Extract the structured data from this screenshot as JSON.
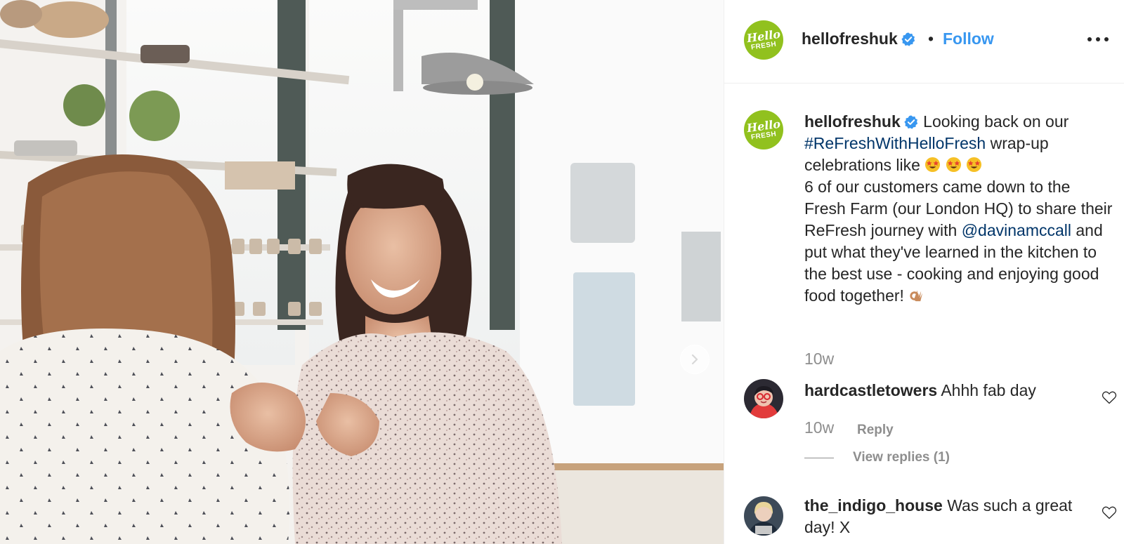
{
  "post": {
    "username": "hellofreshuk",
    "separator": "•",
    "follow_label": "Follow",
    "more_icon": "more-options-icon",
    "avatar_line1": "Hello",
    "avatar_line2": "FRESH",
    "brand_color": "#91c11e",
    "verified_color": "#3897f0"
  },
  "caption": {
    "username": "hellofreshuk",
    "text_1": "Looking back on our",
    "hashtag": "#ReFreshWithHelloFresh",
    "text_2": "wrap-up celebrations like",
    "emoji_1": "star-struck-emoji",
    "text_3": "6 of our customers came down to the Fresh Farm (our London HQ) to share their ReFresh journey with",
    "mention": "@davinamccall",
    "text_4": "and put what they've learned in the kitchen to the best use - cooking and enjoying good food together!",
    "emoji_2": "ok-hand-emoji",
    "time": "10w"
  },
  "comments": [
    {
      "username": "hardcastletowers",
      "text": "Ahhh fab day",
      "time": "10w",
      "reply_label": "Reply",
      "view_replies_label": "View replies (1)"
    },
    {
      "username": "the_indigo_house",
      "text": "Was such a great day! X"
    }
  ],
  "photo": {
    "next_icon": "chevron-right-icon"
  }
}
